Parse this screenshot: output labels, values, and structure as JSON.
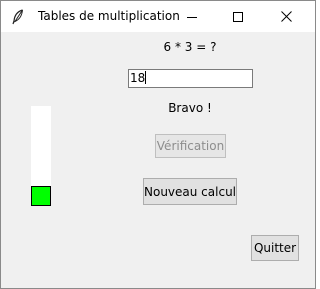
{
  "window": {
    "title": "Tables de multiplication",
    "controls": {
      "minimize_icon": "minimize-icon",
      "maximize_icon": "maximize-icon",
      "close_icon": "close-icon"
    },
    "app_icon": "feather-icon"
  },
  "question": "6 * 3 = ?",
  "answer": {
    "value": "18"
  },
  "feedback": "Bravo !",
  "buttons": {
    "verify_label": "Vérification",
    "verify_enabled": false,
    "new_calc_label": "Nouveau calcul",
    "quit_label": "Quitter"
  },
  "progress": {
    "fraction": 0.2,
    "fill_color": "#00ff00",
    "track_color": "#ffffff"
  }
}
